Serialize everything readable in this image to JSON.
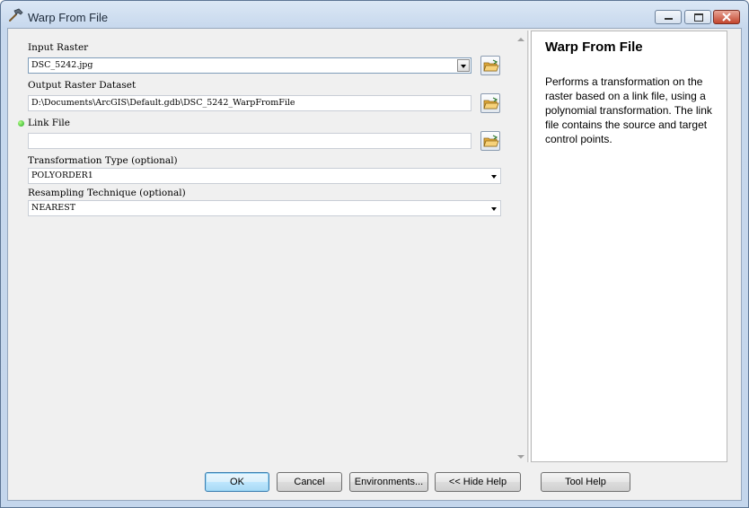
{
  "window": {
    "title": "Warp From File",
    "icon": "hammer-icon"
  },
  "form": {
    "input_raster": {
      "label": "Input Raster",
      "value": "DSC_5242.jpg"
    },
    "output_raster": {
      "label": "Output Raster Dataset",
      "value": "D:\\Documents\\ArcGIS\\Default.gdb\\DSC_5242_WarpFromFile"
    },
    "link_file": {
      "label": "Link File",
      "value": "",
      "required_indicator_color": "#22aa22"
    },
    "transformation": {
      "label": "Transformation Type (optional)",
      "value": "POLYORDER1"
    },
    "resampling": {
      "label": "Resampling Technique (optional)",
      "value": "NEAREST"
    }
  },
  "help": {
    "title": "Warp From File",
    "body": "Performs a transformation on the raster based on a link file, using a polynomial transformation. The link file contains the source and target control points."
  },
  "buttons": {
    "ok": "OK",
    "cancel": "Cancel",
    "environments": "Environments...",
    "hide_help": "<< Hide Help",
    "tool_help": "Tool Help"
  }
}
